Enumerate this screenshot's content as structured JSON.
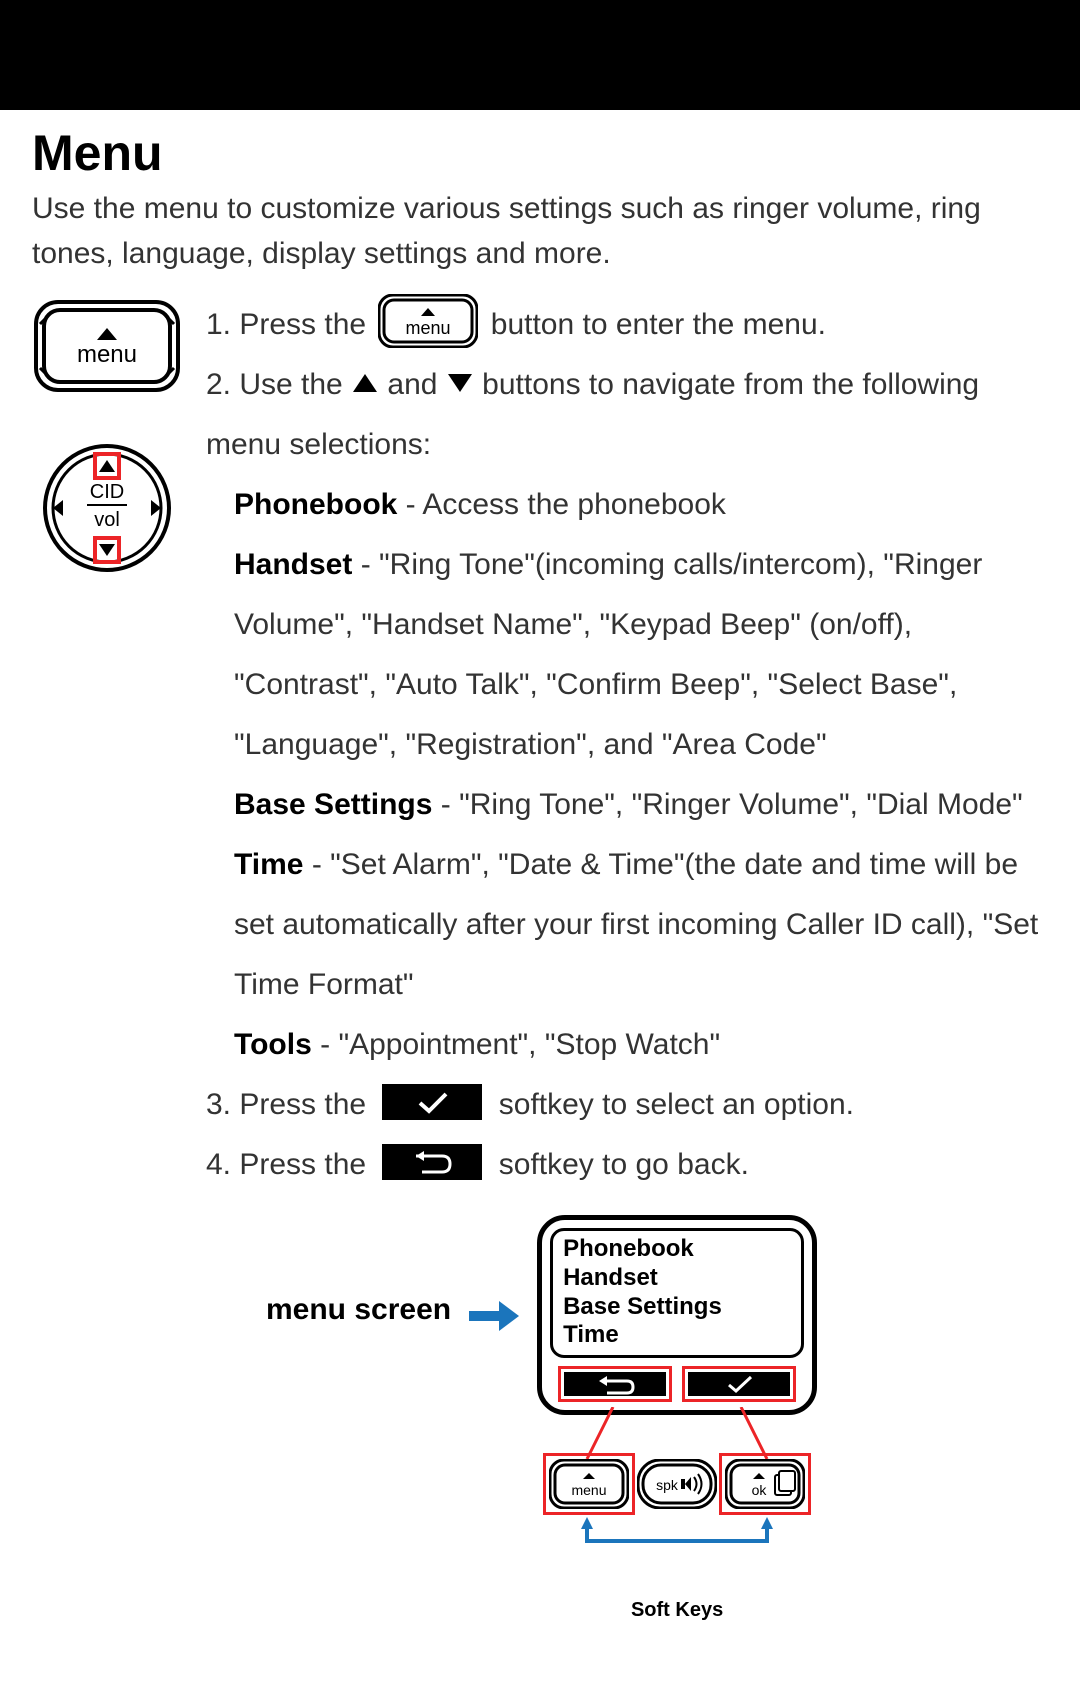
{
  "title": "Menu",
  "intro": "Use the menu to customize various settings such as ringer volume, ring tones, language, display settings and more.",
  "menu_button_label": "menu",
  "dial": {
    "top_label": "CID",
    "bottom_label": "vol"
  },
  "steps": {
    "s1_prefix": "1. Press the ",
    "s1_suffix": " button to enter the menu.",
    "s2_prefix": "2. Use the ",
    "s2_mid": " and ",
    "s2_suffix": " buttons to navigate from the following menu selections:",
    "s3_prefix": "3. Press the ",
    "s3_suffix": " softkey to select an option.",
    "s4_prefix": "4. Press the ",
    "s4_suffix": " softkey to go back."
  },
  "submenu": {
    "phonebook_label": "Phonebook",
    "phonebook_text": " - Access the phonebook",
    "handset_label": "Handset",
    "handset_text": " - \"Ring Tone\"(incoming calls/intercom), \"Ringer Volume\", \"Handset Name\", \"Keypad Beep\" (on/off), \"Contrast\", \"Auto Talk\", \"Confirm Beep\", \"Select Base\", \"Language\", \"Registration\", and \"Area Code\"",
    "base_label": "Base Settings",
    "base_text": " - \"Ring Tone\", \"Ringer Volume\", \"Dial Mode\"",
    "time_label": "Time",
    "time_text": " - \"Set Alarm\", \"Date & Time\"(the date and time will be set automatically after your first incoming Caller ID call), \"Set Time Format\"",
    "tools_label": "Tools",
    "tools_text": " - \"Appointment\", \"Stop Watch\""
  },
  "figure": {
    "label": "menu screen",
    "lcd_items": [
      "Phonebook",
      "Handset",
      "Base Settings",
      "Time"
    ],
    "softkey_caption": "Soft Keys",
    "hw_key_menu": "menu",
    "hw_key_spk": "spk",
    "hw_key_ok": "ok"
  }
}
